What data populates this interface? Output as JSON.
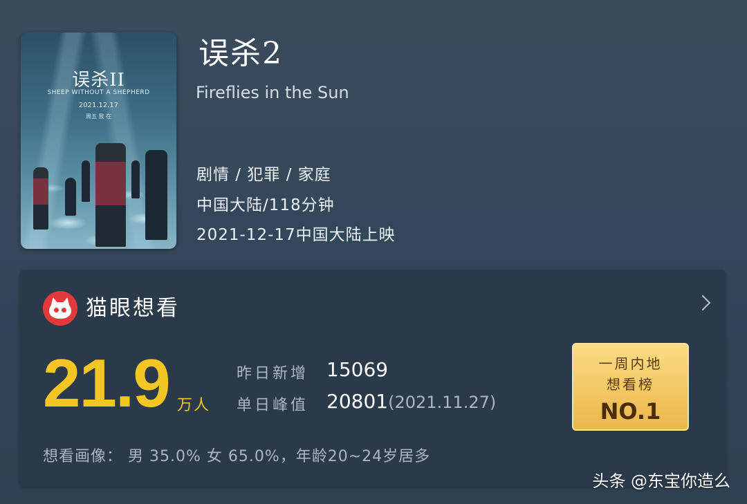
{
  "movie": {
    "title_cn": "误杀2",
    "title_en": "Fireflies in the Sun",
    "genres": "剧情 / 犯罪 / 家庭",
    "region_duration": "中国大陆/118分钟",
    "release": "2021-12-17中国大陆上映"
  },
  "poster": {
    "title": "误杀II",
    "subtitle": "SHEEP WITHOUT A SHEPHERD",
    "date": "2021.12.17",
    "tag": "周五 我 在"
  },
  "maoyan": {
    "logo_icon": "cat-logo-icon",
    "title": "猫眼想看",
    "want_count": "21.9",
    "want_unit": "万人",
    "yesterday_label": "昨日新增",
    "yesterday_value": "15069",
    "peak_label": "单日峰值",
    "peak_value": "20801",
    "peak_date": "(2021.11.27)",
    "badge_line1": "一周内地",
    "badge_line2": "想看榜",
    "badge_rank": "NO.1",
    "demographics": "想看画像： 男  35.0%   女  65.0%，年龄20~24岁居多"
  },
  "colors": {
    "accent_yellow": "#f3c623",
    "logo_red": "#e23a3a"
  },
  "watermark": "头条 @东宝你造么"
}
